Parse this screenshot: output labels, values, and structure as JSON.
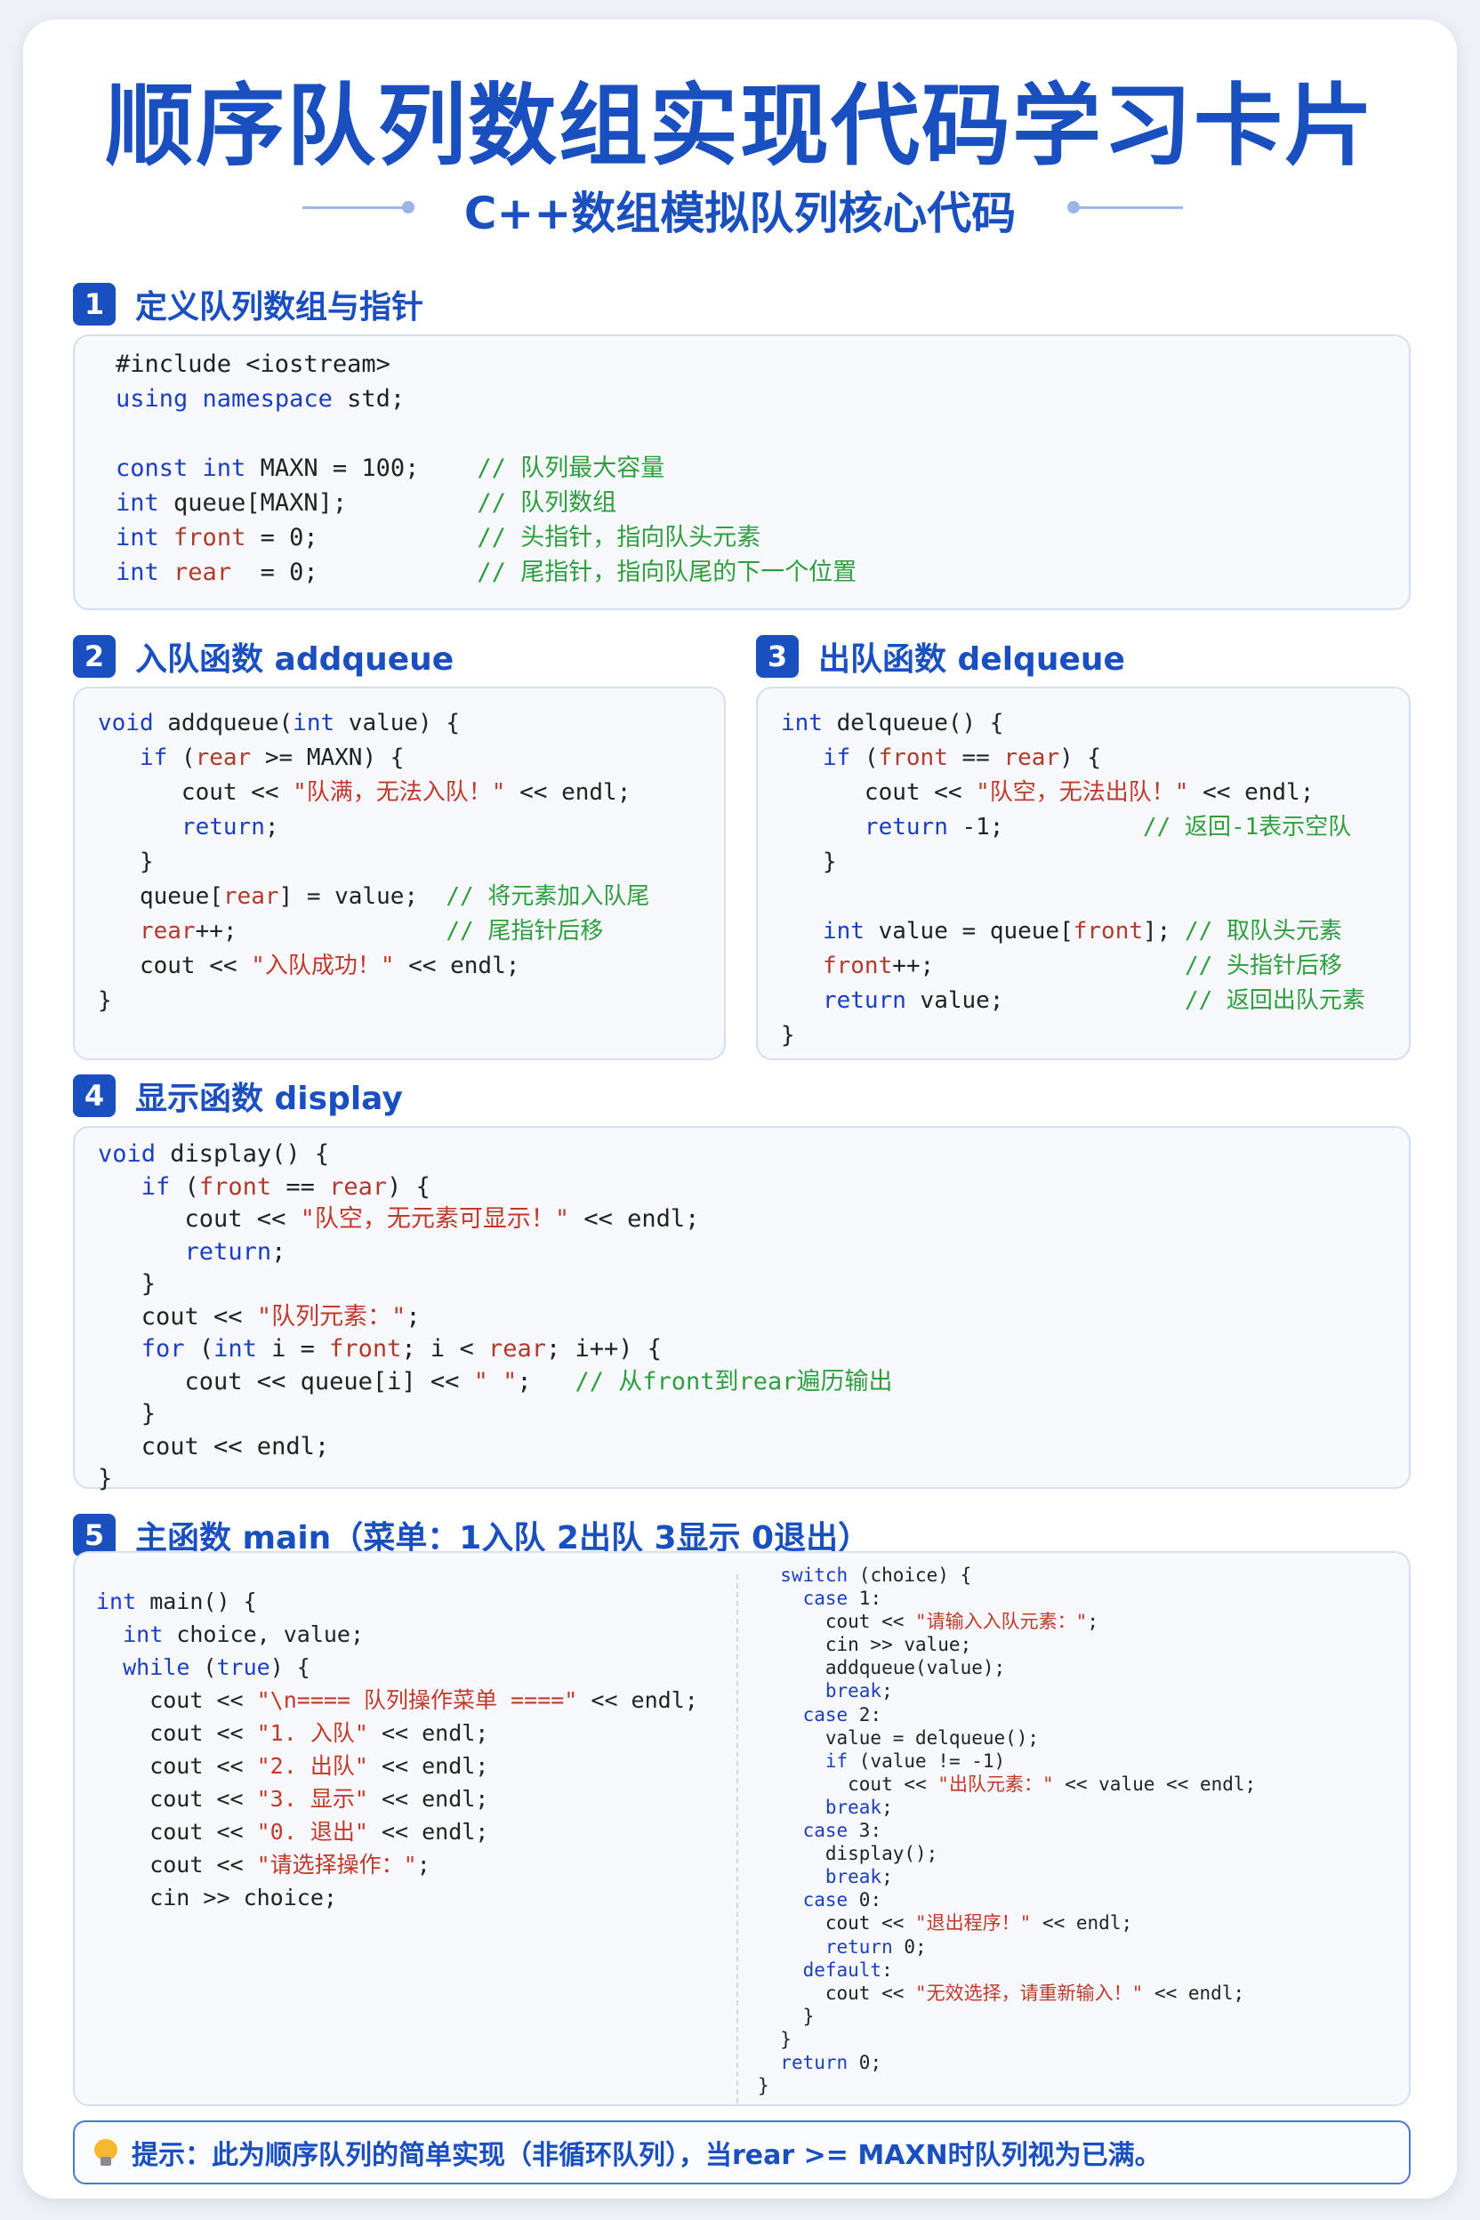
{
  "title": "顺序队列数组实现代码学习卡片",
  "subtitle": "C++数组模拟队列核心代码",
  "sections": [
    {
      "num": "1",
      "title": "定义队列数组与指针"
    },
    {
      "num": "2",
      "title": "入队函数 addqueue"
    },
    {
      "num": "3",
      "title": "出队函数 delqueue"
    },
    {
      "num": "4",
      "title": "显示函数 display"
    },
    {
      "num": "5",
      "title": "主函数 main（菜单：1入队 2出队 3显示 0退出）"
    }
  ],
  "code": {
    "s1": [
      "#include <iostream>",
      "using namespace std;",
      "",
      "const int MAXN = 100;    // 队列最大容量",
      "int queue[MAXN];         // 队列数组",
      "int front = 0;           // 头指针，指向队头元素",
      "int rear  = 0;           // 尾指针，指向队尾的下一个位置"
    ],
    "s2": [
      "void addqueue(int value) {",
      "   if (rear >= MAXN) {",
      "      cout << \"队满，无法入队！\" << endl;",
      "      return;",
      "   }",
      "   queue[rear] = value;  // 将元素加入队尾",
      "   rear++;               // 尾指针后移",
      "   cout << \"入队成功！\" << endl;",
      "}"
    ],
    "s3": [
      "int delqueue() {",
      "   if (front == rear) {",
      "      cout << \"队空，无法出队！\" << endl;",
      "      return -1;          // 返回-1表示空队",
      "   }",
      "",
      "   int value = queue[front]; // 取队头元素",
      "   front++;                  // 头指针后移",
      "   return value;             // 返回出队元素",
      "}"
    ],
    "s4": [
      "void display() {",
      "   if (front == rear) {",
      "      cout << \"队空，无元素可显示！\" << endl;",
      "      return;",
      "   }",
      "   cout << \"队列元素：\";",
      "   for (int i = front; i < rear; i++) {",
      "      cout << queue[i] << \" \";   // 从front到rear遍历输出",
      "   }",
      "   cout << endl;",
      "}"
    ],
    "s5_left": [
      "int main() {",
      "  int choice, value;",
      "  while (true) {",
      "    cout << \"\\n==== 队列操作菜单 ====\" << endl;",
      "    cout << \"1. 入队\" << endl;",
      "    cout << \"2. 出队\" << endl;",
      "    cout << \"3. 显示\" << endl;",
      "    cout << \"0. 退出\" << endl;",
      "    cout << \"请选择操作：\";",
      "    cin >> choice;"
    ],
    "s5_right": [
      "  switch (choice) {",
      "    case 1:",
      "      cout << \"请输入入队元素：\";",
      "      cin >> value;",
      "      addqueue(value);",
      "      break;",
      "    case 2:",
      "      value = delqueue();",
      "      if (value != -1)",
      "        cout << \"出队元素：\" << value << endl;",
      "      break;",
      "    case 3:",
      "      display();",
      "      break;",
      "    case 0:",
      "      cout << \"退出程序！\" << endl;",
      "      return 0;",
      "    default:",
      "      cout << \"无效选择，请重新输入！\" << endl;",
      "    }",
      "  }",
      "  return 0;",
      "}"
    ]
  },
  "tip": "提示：此为顺序队列的简单实现（非循环队列），当rear >= MAXN时队列视为已满。"
}
